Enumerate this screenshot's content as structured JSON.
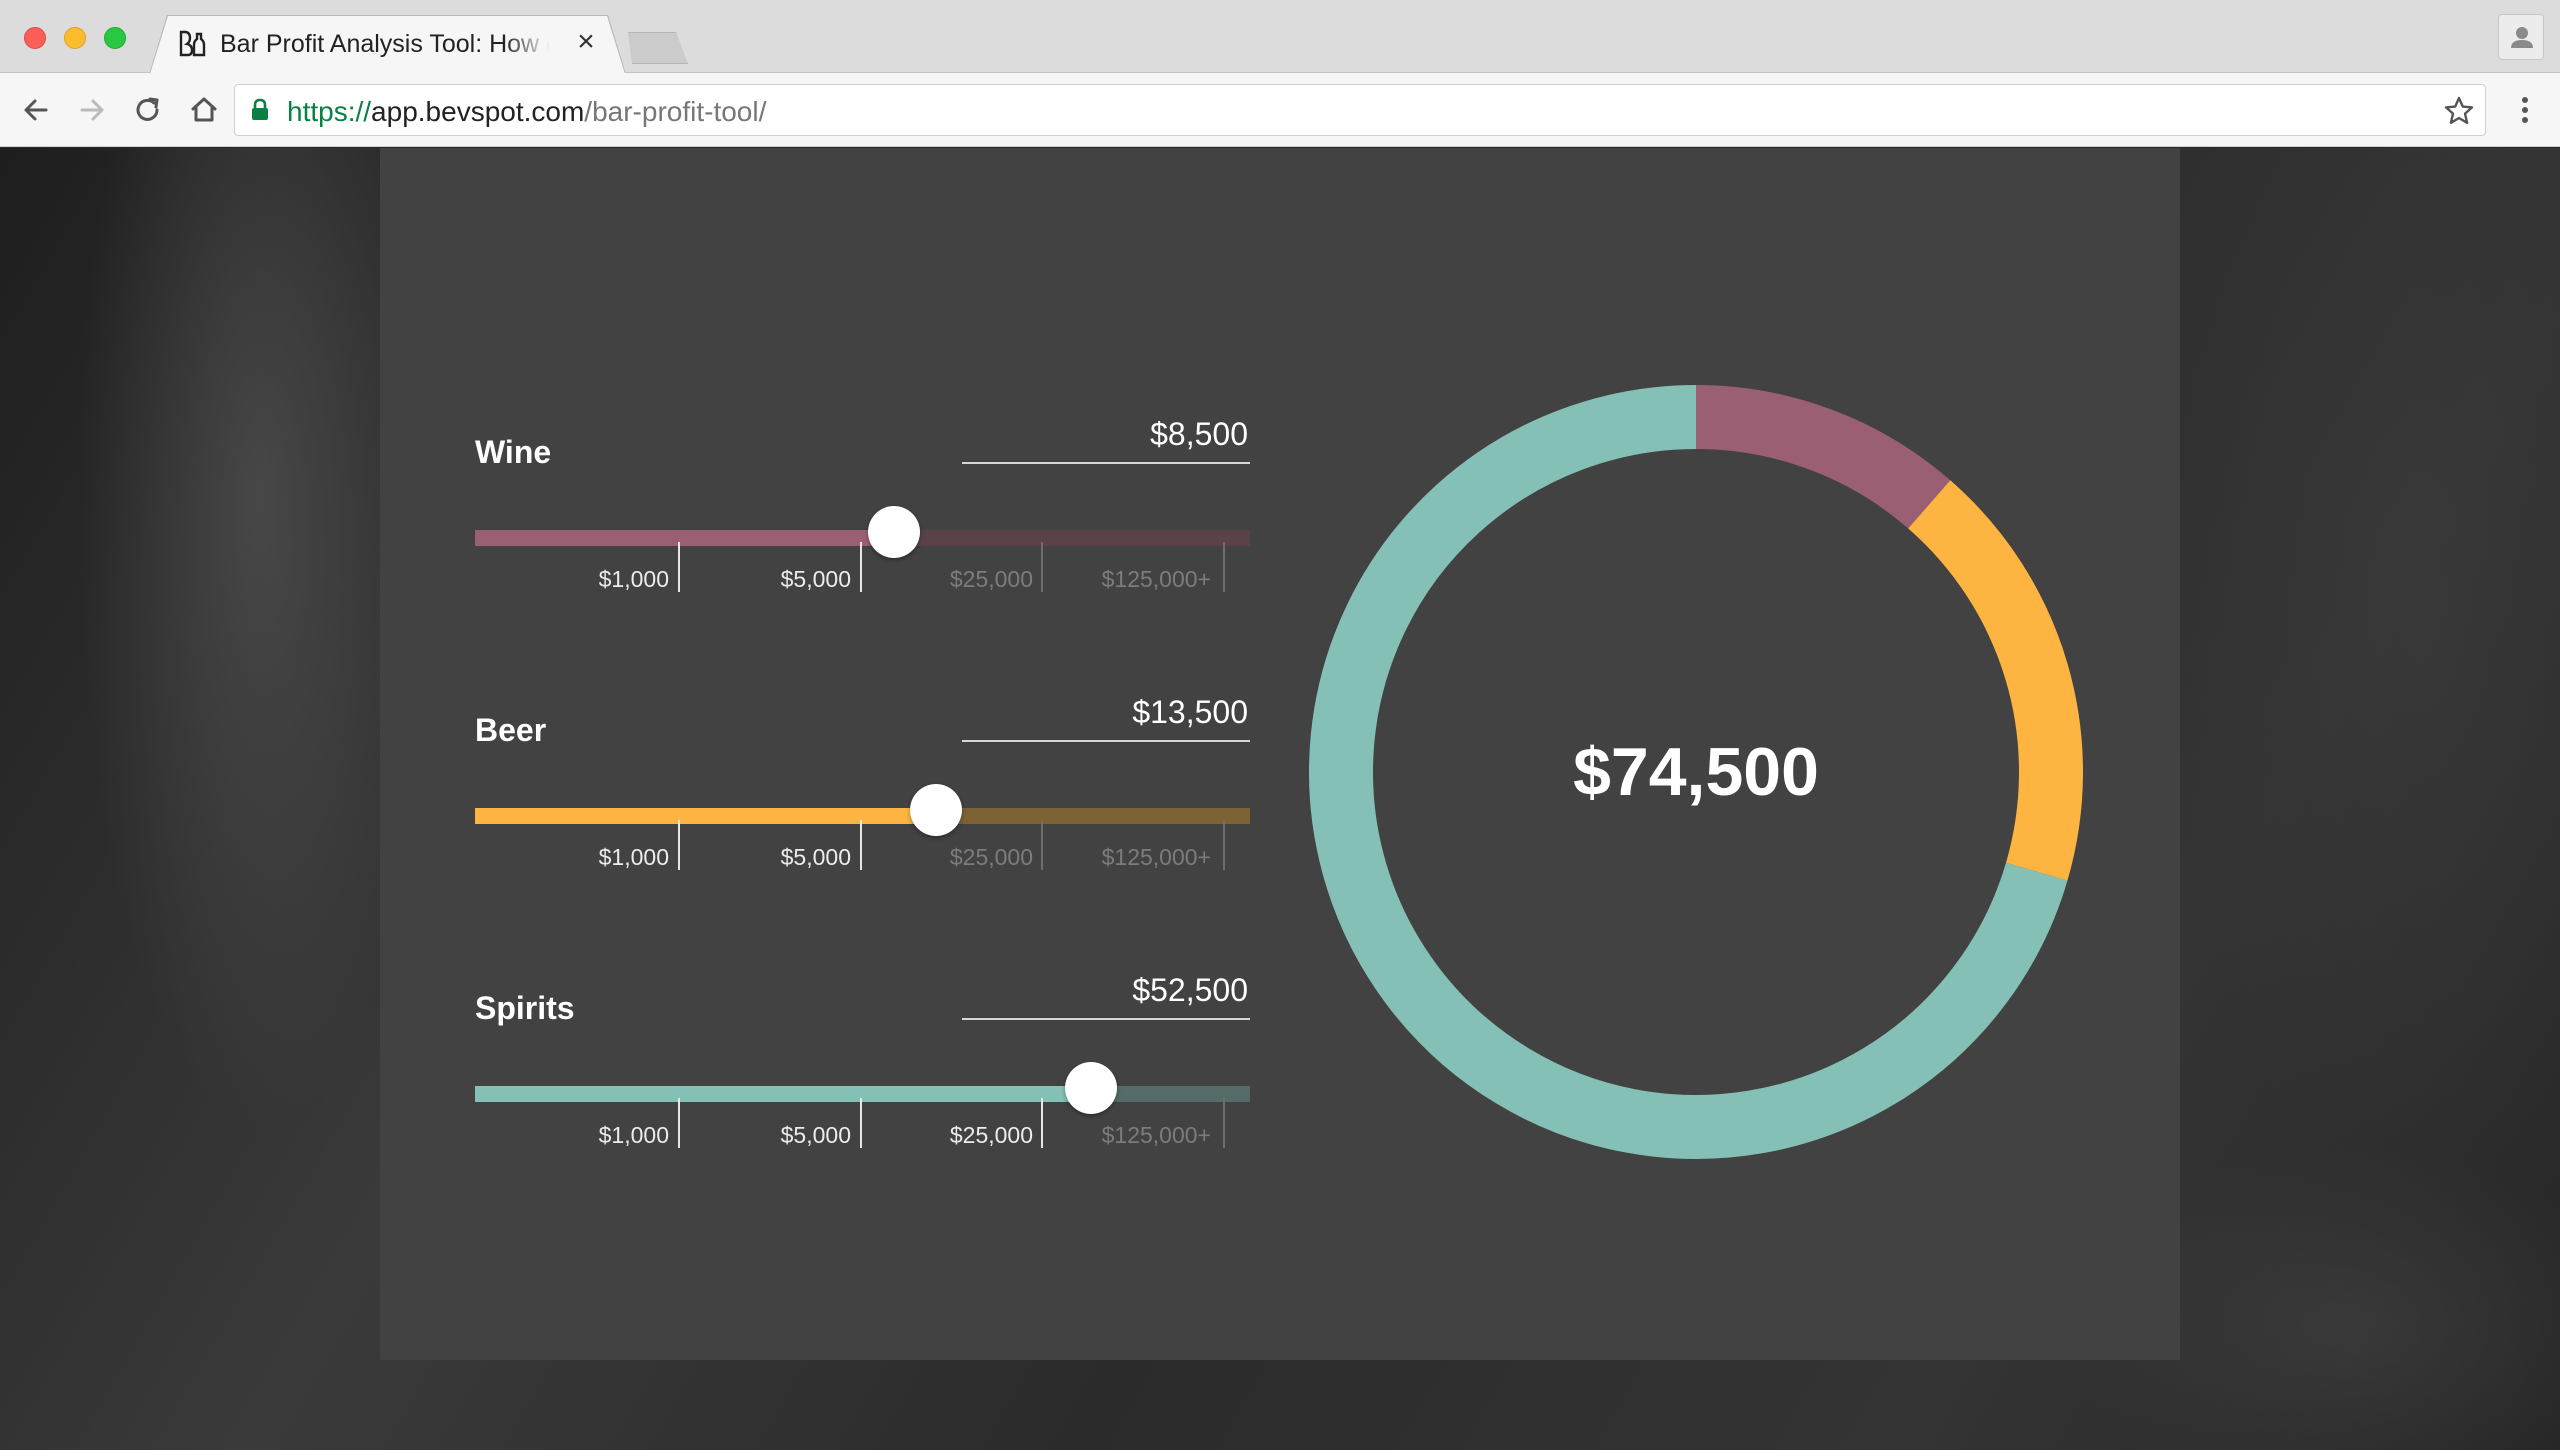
{
  "browser": {
    "tab_title": "Bar Profit Analysis Tool: How c",
    "close_glyph": "×",
    "url_scheme": "https://",
    "url_host": "app.bevspot.com",
    "url_path": "/bar-profit-tool/"
  },
  "categories": [
    {
      "label": "Wine",
      "amount": "$8,500",
      "color": "#9b5f73",
      "track": "#5a4248",
      "level": 0.54,
      "active_ticks": 2
    },
    {
      "label": "Beer",
      "amount": "$13,500",
      "color": "#fdb441",
      "track": "#7d6233",
      "level": 0.595,
      "active_ticks": 2
    },
    {
      "label": "Spirits",
      "amount": "$52,500",
      "color": "#84c0b6",
      "track": "#556b67",
      "level": 0.795,
      "active_ticks": 3
    }
  ],
  "tick_labels": [
    "$1,000",
    "$5,000",
    "$25,000",
    "$125,000+"
  ],
  "donut": {
    "total": "$74,500",
    "segments": [
      {
        "name": "Wine",
        "value": 8500,
        "color": "#9b5f73"
      },
      {
        "name": "Beer",
        "value": 13500,
        "color": "#fdb441"
      },
      {
        "name": "Spirits",
        "value": 52500,
        "color": "#84c0b6"
      }
    ]
  }
}
